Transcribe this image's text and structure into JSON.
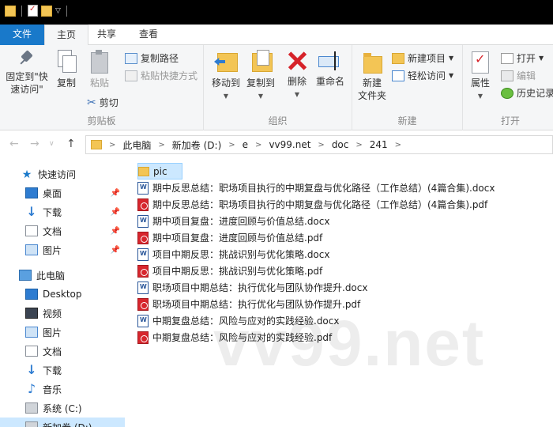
{
  "ribbon_tabs": {
    "file": "文件",
    "home": "主页",
    "share": "共享",
    "view": "查看"
  },
  "clipboard": {
    "pin_label": "固定到\"快\n速访问\"",
    "copy_label": "复制",
    "paste_label": "粘贴",
    "copy_path": "复制路径",
    "paste_shortcut": "粘贴快捷方式",
    "cut": "剪切",
    "group_label": "剪贴板"
  },
  "organize": {
    "move_to": "移动到",
    "copy_to": "复制到",
    "delete": "删除",
    "rename": "重命名",
    "group_label": "组织"
  },
  "new": {
    "new_folder": "新建\n文件夹",
    "new_item": "新建项目",
    "easy_access": "轻松访问",
    "group_label": "新建"
  },
  "open": {
    "properties": "属性",
    "open": "打开",
    "edit": "编辑",
    "history": "历史记录",
    "group_label": "打开"
  },
  "address": {
    "crumbs": [
      "此电脑",
      "新加卷 (D:)",
      "e",
      "vv99.net",
      "doc",
      "241"
    ]
  },
  "nav": {
    "quick_access": "快速访问",
    "desktop": "桌面",
    "downloads": "下载",
    "documents": "文档",
    "pictures": "图片",
    "this_pc": "此电脑",
    "pc_desktop": "Desktop",
    "videos": "视频",
    "pc_pictures": "图片",
    "pc_documents": "文档",
    "pc_downloads": "下载",
    "music": "音乐",
    "drive_c": "系统 (C:)",
    "drive_d": "新加卷 (D:)"
  },
  "files": [
    {
      "name": "pic",
      "type": "folder"
    },
    {
      "name": "期中反思总结：职场项目执行的中期复盘与优化路径（工作总结）(4篇合集).docx",
      "type": "word"
    },
    {
      "name": "期中反思总结：职场项目执行的中期复盘与优化路径（工作总结）(4篇合集).pdf",
      "type": "pdf"
    },
    {
      "name": "期中项目复盘：进度回顾与价值总结.docx",
      "type": "word"
    },
    {
      "name": "期中项目复盘：进度回顾与价值总结.pdf",
      "type": "pdf"
    },
    {
      "name": "项目中期反思：挑战识别与优化策略.docx",
      "type": "word"
    },
    {
      "name": "项目中期反思：挑战识别与优化策略.pdf",
      "type": "pdf"
    },
    {
      "name": "职场项目中期总结：执行优化与团队协作提升.docx",
      "type": "word"
    },
    {
      "name": "职场项目中期总结：执行优化与团队协作提升.pdf",
      "type": "pdf"
    },
    {
      "name": "中期复盘总结：风险与应对的实践经验.docx",
      "type": "word"
    },
    {
      "name": "中期复盘总结：风险与应对的实践经验.pdf",
      "type": "pdf"
    }
  ],
  "watermark": "vv99.net",
  "colors": {
    "accent": "#1979ca",
    "selection": "#cce8ff",
    "folder": "#f3c555",
    "pdf": "#d7262d",
    "word": "#2b579a"
  }
}
